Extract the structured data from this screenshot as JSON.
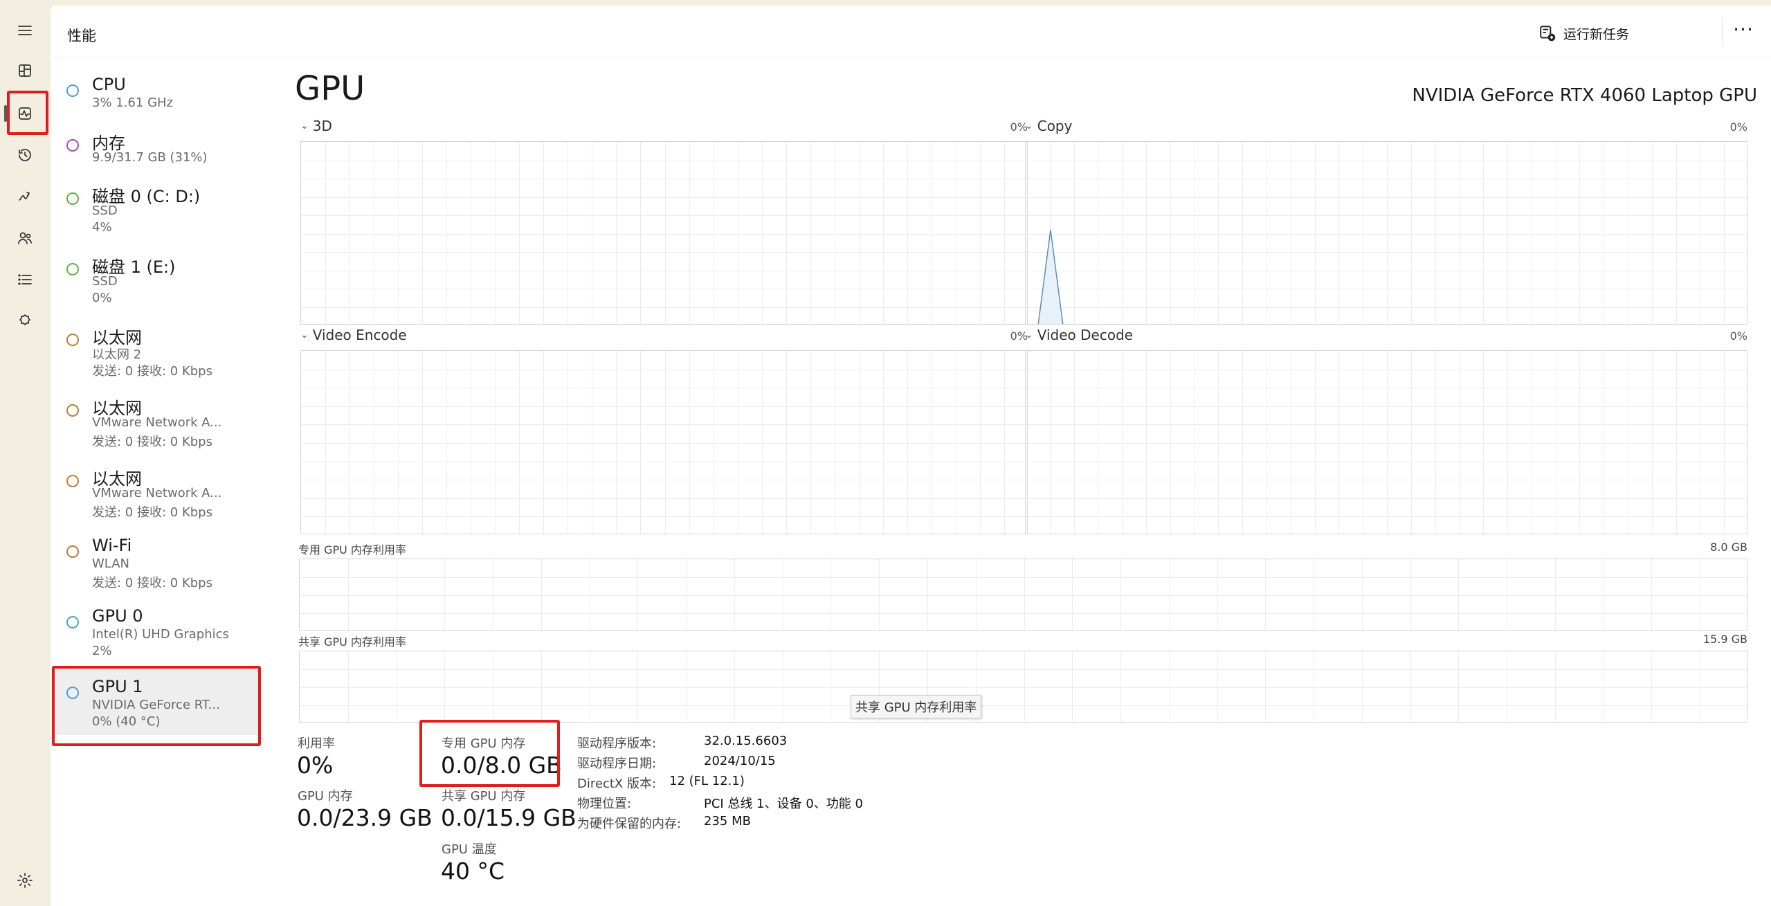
{
  "app": {
    "page_title": "性能",
    "run_new_task_label": "运行新任务",
    "more_label": "···"
  },
  "rail": {
    "icons": [
      "hamburger-menu",
      "processes",
      "performance",
      "app-history",
      "startup-apps",
      "users",
      "details",
      "services",
      "settings"
    ],
    "active": "performance"
  },
  "devices": [
    {
      "name": "CPU",
      "sub1": "3%  1.61 GHz",
      "sub2": "",
      "color": "#4a9fd8"
    },
    {
      "name": "内存",
      "sub1": "9.9/31.7 GB (31%)",
      "sub2": "",
      "color": "#a34bc4"
    },
    {
      "name": "磁盘 0 (C: D:)",
      "sub1": "SSD",
      "sub2": "4%",
      "color": "#5fb340"
    },
    {
      "name": "磁盘 1 (E:)",
      "sub1": "SSD",
      "sub2": "0%",
      "color": "#5fb340"
    },
    {
      "name": "以太网",
      "sub1": "以太网 2",
      "sub2": "发送: 0 接收: 0 Kbps",
      "color": "#c07a33"
    },
    {
      "name": "以太网",
      "sub1": "VMware Network A...",
      "sub2": "发送: 0 接收: 0 Kbps",
      "color": "#c07a33"
    },
    {
      "name": "以太网",
      "sub1": "VMware Network A...",
      "sub2": "发送: 0 接收: 0 Kbps",
      "color": "#c07a33"
    },
    {
      "name": "Wi-Fi",
      "sub1": "WLAN",
      "sub2": "发送: 0 接收: 0 Kbps",
      "color": "#c07a33"
    },
    {
      "name": "GPU 0",
      "sub1": "Intel(R) UHD Graphics",
      "sub2": "2%",
      "color": "#4a9fd8"
    },
    {
      "name": "GPU 1",
      "sub1": "NVIDIA GeForce RT...",
      "sub2": "0% (40 °C)",
      "color": "#4a9fd8"
    }
  ],
  "selected_device": "GPU 1",
  "gpu": {
    "heading": "GPU",
    "model": "NVIDIA GeForce RTX 4060 Laptop GPU",
    "engines": [
      {
        "name": "3D",
        "percent": "0%"
      },
      {
        "name": "Copy",
        "percent": "0%"
      },
      {
        "name": "Video Encode",
        "percent": "0%"
      },
      {
        "name": "Video Decode",
        "percent": "0%"
      }
    ],
    "copy_spike_percent": 52,
    "dedicated_mem_label": "专用 GPU 内存利用率",
    "dedicated_mem_capacity": "8.0 GB",
    "shared_mem_label": "共享 GPU 内存利用率",
    "shared_mem_capacity": "15.9 GB",
    "tooltip": "共享 GPU 内存利用率",
    "stats": {
      "utilization_label": "利用率",
      "utilization_value": "0%",
      "gpu_mem_label": "GPU 内存",
      "gpu_mem_value": "0.0/23.9 GB",
      "dedicated_label": "专用 GPU 内存",
      "dedicated_value": "0.0/8.0 GB",
      "shared_label": "共享 GPU 内存",
      "shared_value": "0.0/15.9 GB",
      "temp_label": "GPU 温度",
      "temp_value": "40 °C"
    },
    "info": [
      {
        "key": "驱动程序版本:",
        "value": "32.0.15.6603"
      },
      {
        "key": "驱动程序日期:",
        "value": "2024/10/15"
      },
      {
        "key": "DirectX 版本:",
        "value": "12 (FL 12.1)"
      },
      {
        "key": "物理位置:",
        "value": "PCI 总线 1、设备 0、功能 0"
      },
      {
        "key": "为硬件保留的内存:",
        "value": "235 MB"
      }
    ]
  },
  "colors": {
    "graph_line": "#5a8fb8",
    "graph_fill": "#e8f1f8",
    "grid": "#ececec",
    "highlight": "#e01d1d"
  }
}
